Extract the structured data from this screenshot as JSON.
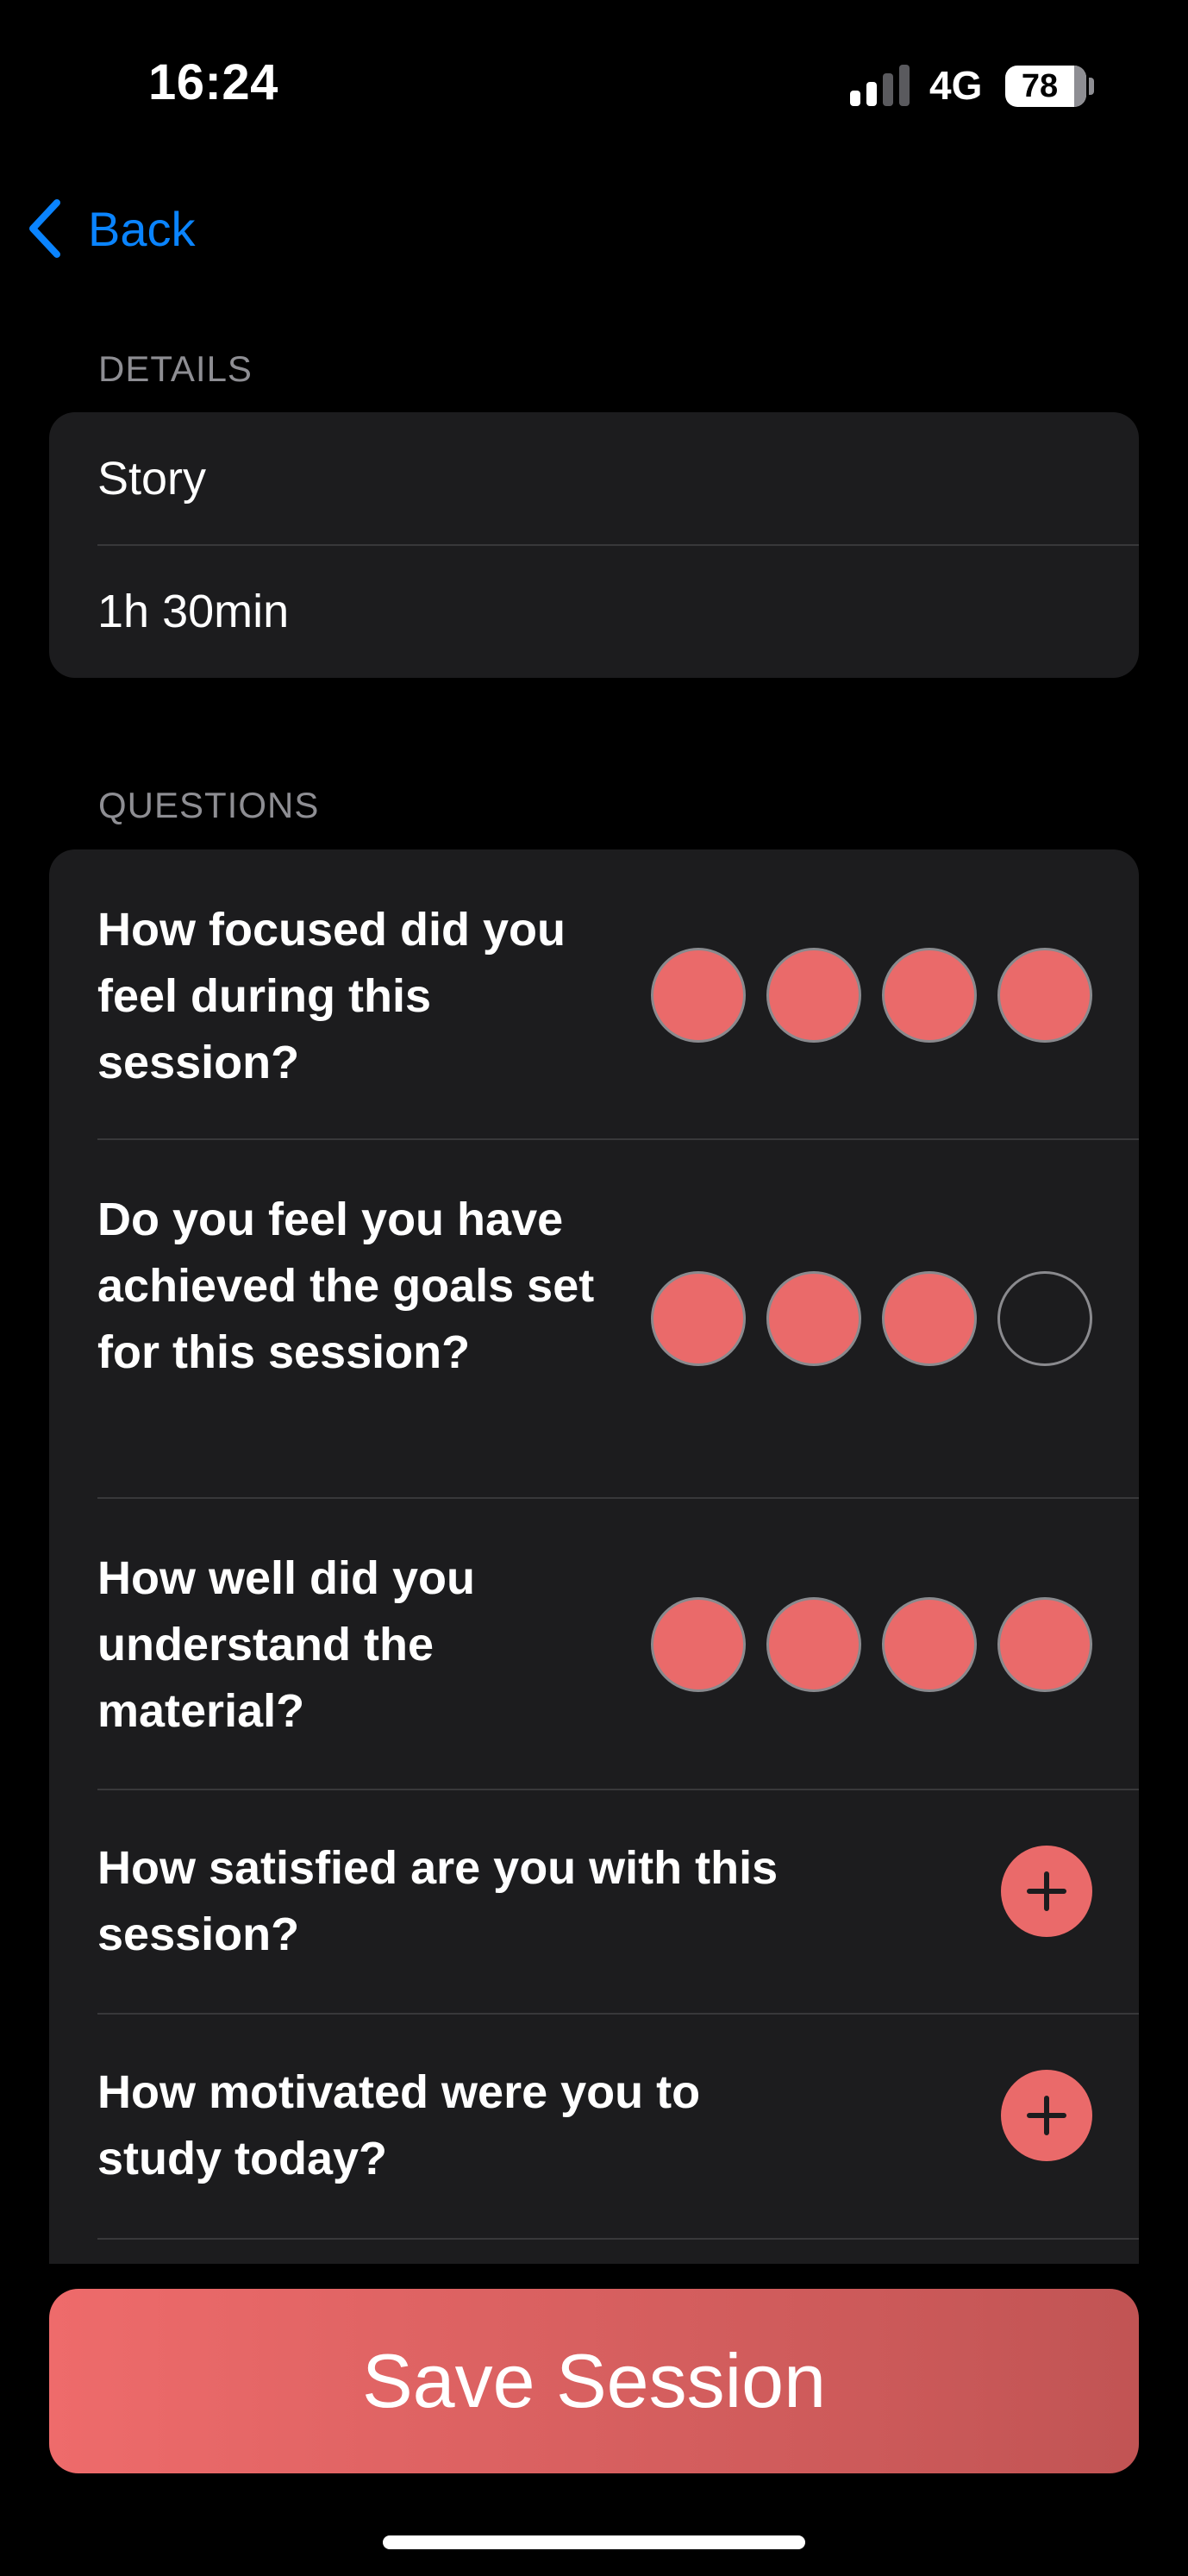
{
  "status_bar": {
    "time": "16:24",
    "network": "4G",
    "battery": "78"
  },
  "nav": {
    "back_label": "Back"
  },
  "details": {
    "header": "DETAILS",
    "rows": [
      "Story",
      "1h 30min"
    ]
  },
  "questions": {
    "header": "QUESTIONS",
    "items": [
      {
        "text": "How focused did you feel during this session?",
        "rating": 4,
        "max": 4
      },
      {
        "text": "Do you feel you have achieved the goals set for this session?",
        "rating": 3,
        "max": 4
      },
      {
        "text": "How well did you understand the material?",
        "rating": 4,
        "max": 4
      },
      {
        "text": "How satisfied are you with this session?",
        "rating": null
      },
      {
        "text": "How motivated were you to study today?",
        "rating": null
      }
    ]
  },
  "save_label": "Save Session",
  "colors": {
    "accent": "#ea6a6a",
    "link": "#0a84ff",
    "card": "#1c1c1e"
  },
  "icons": {
    "back": "chevron-left-icon",
    "add": "plus-icon"
  }
}
